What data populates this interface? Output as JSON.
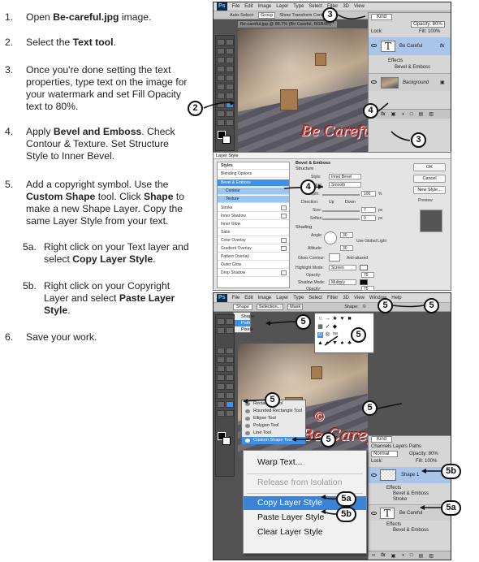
{
  "steps": [
    {
      "num": "1.",
      "parts": [
        {
          "t": "Open "
        },
        {
          "t": "Be-careful.jpg",
          "b": true
        },
        {
          "t": " image."
        }
      ]
    },
    {
      "num": "2.",
      "parts": [
        {
          "t": "Select the "
        },
        {
          "t": "Text tool",
          "b": true
        },
        {
          "t": "."
        }
      ]
    },
    {
      "num": "3.",
      "parts": [
        {
          "t": "Once you're done setting the text properties, type text on the image for your watermark and set Fill Opacity text to 80%."
        }
      ]
    },
    {
      "num": "4.",
      "parts": [
        {
          "t": "Apply "
        },
        {
          "t": "Bevel and Emboss",
          "b": true
        },
        {
          "t": ". Check Contour & Texture. Set Structure Style to Inner Bevel."
        }
      ]
    },
    {
      "num": "5.",
      "parts": [
        {
          "t": "Add a copyright symbol. Use the "
        },
        {
          "t": "Custom Shape",
          "b": true
        },
        {
          "t": " tool. Click "
        },
        {
          "t": "Shape",
          "b": true
        },
        {
          "t": " to make a new Shape Layer. Copy the same Layer Style from your text."
        }
      ]
    },
    {
      "num": "5a.",
      "parts": [
        {
          "t": "Right click on your Text layer and select "
        },
        {
          "t": "Copy Layer Style",
          "b": true
        },
        {
          "t": "."
        }
      ]
    },
    {
      "num": "5b.",
      "parts": [
        {
          "t": "Right click on your Copyright Layer and select "
        },
        {
          "t": "Paste Layer Style",
          "b": true
        },
        {
          "t": "."
        }
      ]
    },
    {
      "num": "6.",
      "parts": [
        {
          "t": "Save your work."
        }
      ]
    }
  ],
  "ps_top": {
    "logo": "Ps",
    "menu": [
      "File",
      "Edit",
      "Image",
      "Layer",
      "Type",
      "Select",
      "Filter",
      "3D",
      "View"
    ],
    "options": [
      "Auto-Select:",
      "Group",
      "Show Transform Controls"
    ],
    "doc_tab": "Be-careful.jpg @ 88.7% (Be Careful, RGB/8#) *",
    "watermark": "Be Careful",
    "layers": {
      "kind": "Kind",
      "opacity": "Opacity: 80%",
      "lock": "Lock:",
      "fill": "Fill: 100%",
      "text_layer": "Be Careful",
      "fx": "fx",
      "effects": "Effects",
      "effect_item": "Bevel & Emboss",
      "bg_layer": "Background"
    }
  },
  "dialog": {
    "title": "Layer Style",
    "list": [
      "Styles",
      "Blending Options",
      "Bevel & Emboss",
      "Contour",
      "Texture",
      "Stroke",
      "Inner Shadow",
      "Inner Glow",
      "Satin",
      "Color Overlay",
      "Gradient Overlay",
      "Pattern Overlay",
      "Outer Glow",
      "Drop Shadow"
    ],
    "sections": {
      "main": "Bevel & Emboss",
      "structure": "Structure",
      "shading": "Shading"
    },
    "labels": {
      "style": "Style:",
      "style_val": "Inner Bevel",
      "technique": "Technique:",
      "technique_val": "Smooth",
      "depth": "Depth:",
      "depth_val": "100",
      "direction": "Direction:",
      "up": "Up",
      "down": "Down",
      "size": "Size:",
      "size_val": "7",
      "soften": "Soften:",
      "soften_val": "0",
      "angle": "Angle:",
      "angle_val": "30",
      "global_light": "Use Global Light",
      "altitude": "Altitude:",
      "altitude_val": "30",
      "gloss": "Gloss Contour:",
      "anti": "Anti-aliased",
      "hl_mode": "Highlight Mode:",
      "hl_val": "Screen",
      "opacity": "Opacity:",
      "op_val": "75",
      "sh_mode": "Shadow Mode:",
      "sh_val": "Multiply",
      "opacity2": "Opacity:",
      "op2_val": "75",
      "px": "px",
      "pct": "%"
    },
    "buttons": [
      "OK",
      "Cancel",
      "New Style...",
      "Preview"
    ]
  },
  "ps_bottom": {
    "logo": "Ps",
    "menu": [
      "File",
      "Edit",
      "Image",
      "Layer",
      "Type",
      "Select",
      "Filter",
      "3D",
      "View",
      "Window",
      "Help"
    ],
    "options": [
      "Shape",
      "Selection...",
      "Mask",
      "Shape:"
    ],
    "shape_modes": [
      "Shape",
      "Path",
      "Pixels"
    ],
    "tool_flyout": [
      "Rectangle Tool",
      "Rounded Rectangle Tool",
      "Ellipse Tool",
      "Polygon Tool",
      "Line Tool",
      "Custom Shape Tool"
    ],
    "tool_shortcut": "U",
    "watermark": "Be Careful",
    "copyright": "©",
    "layers": {
      "kind": "Kind",
      "tabs": "Channels  Layers  Paths",
      "blend": "Normal",
      "opacity": "Opacity: 80%",
      "lock": "Lock:",
      "fill": "Fill: 100%",
      "shape_layer": "Shape 1",
      "effects": "Effects",
      "fx1": "Bevel & Emboss",
      "fx2": "Stroke",
      "text_layer": "Be Careful",
      "effects2": "Effects",
      "fx3": "Bevel & Emboss"
    }
  },
  "context_menu": [
    "Warp Text...",
    "Release from Isolation",
    "Copy Layer Style",
    "Paste Layer Style",
    "Clear Layer Style"
  ],
  "callouts": {
    "two": "2",
    "three": "3",
    "four": "4",
    "five": "5",
    "fiveA": "5a",
    "fiveB": "5b"
  }
}
